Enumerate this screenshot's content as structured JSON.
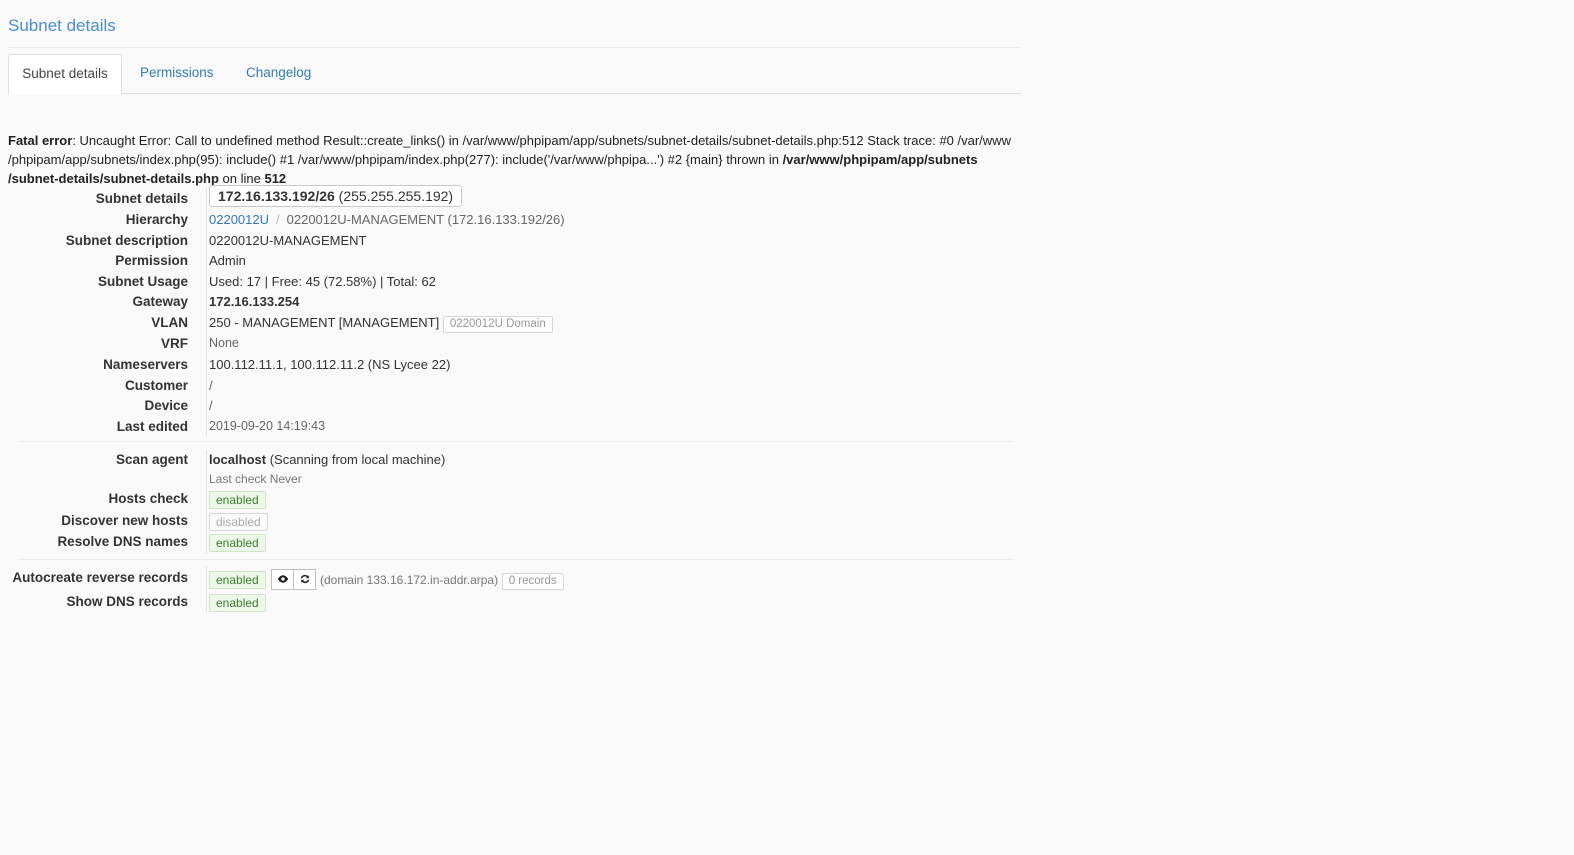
{
  "page": {
    "title": "Subnet details"
  },
  "tabs": [
    {
      "label": "Subnet details"
    },
    {
      "label": "Permissions"
    },
    {
      "label": "Changelog"
    }
  ],
  "error": {
    "prefix": "Fatal error",
    "message": ": Uncaught Error: Call to undefined method Result::create_links() in /var/www/phpipam/app/subnets/subnet-details/subnet-details.php:512 Stack trace: #0 /var/www /phpipam/app/subnets/index.php(95): include() #1 /var/www/phpipam/index.php(277): include('/var/www/phpipa...') #2 {main} thrown in ",
    "file": "/var/www/phpipam/app/subnets /subnet-details/subnet-details.php",
    "online": " on line ",
    "line": "512"
  },
  "details": {
    "subnet": {
      "label": "Subnet details",
      "cidr": "172.16.133.192/26",
      "mask": "(255.255.255.192)"
    },
    "hierarchy": {
      "label": "Hierarchy",
      "parent": "0220012U",
      "sep": "/",
      "current": "0220012U-MANAGEMENT (172.16.133.192/26)"
    },
    "description": {
      "label": "Subnet description",
      "value": "0220012U-MANAGEMENT"
    },
    "permission": {
      "label": "Permission",
      "value": "Admin"
    },
    "usage": {
      "label": "Subnet Usage",
      "value": "Used: 17 | Free: 45 (72.58%) | Total: 62"
    },
    "gateway": {
      "label": "Gateway",
      "value": "172.16.133.254"
    },
    "vlan": {
      "label": "VLAN",
      "value": "250 - MANAGEMENT [MANAGEMENT]",
      "domain": "0220012U Domain"
    },
    "vrf": {
      "label": "VRF",
      "value": "None"
    },
    "nameservers": {
      "label": "Nameservers",
      "value": "100.112.11.1, 100.112.11.2 (NS Lycee 22)"
    },
    "customer": {
      "label": "Customer",
      "value": "/"
    },
    "device": {
      "label": "Device",
      "value": "/"
    },
    "last_edited": {
      "label": "Last edited",
      "value": "2019-09-20 14:19:43"
    }
  },
  "scan": {
    "agent": {
      "label": "Scan agent",
      "name": "localhost",
      "desc": "(Scanning from local machine)",
      "last_check": "Last check Never"
    },
    "hosts_check": {
      "label": "Hosts check",
      "status": "enabled"
    },
    "discover": {
      "label": "Discover new hosts",
      "status": "disabled"
    },
    "resolve": {
      "label": "Resolve DNS names",
      "status": "enabled"
    }
  },
  "dns": {
    "autocreate": {
      "label": "Autocreate reverse records",
      "status": "enabled",
      "domain_text": "(domain 133.16.172.in-addr.arpa)",
      "records": "0 records"
    },
    "show": {
      "label": "Show DNS records",
      "status": "enabled"
    }
  },
  "icons": {
    "view": "eye-icon",
    "refresh": "refresh-icon"
  }
}
